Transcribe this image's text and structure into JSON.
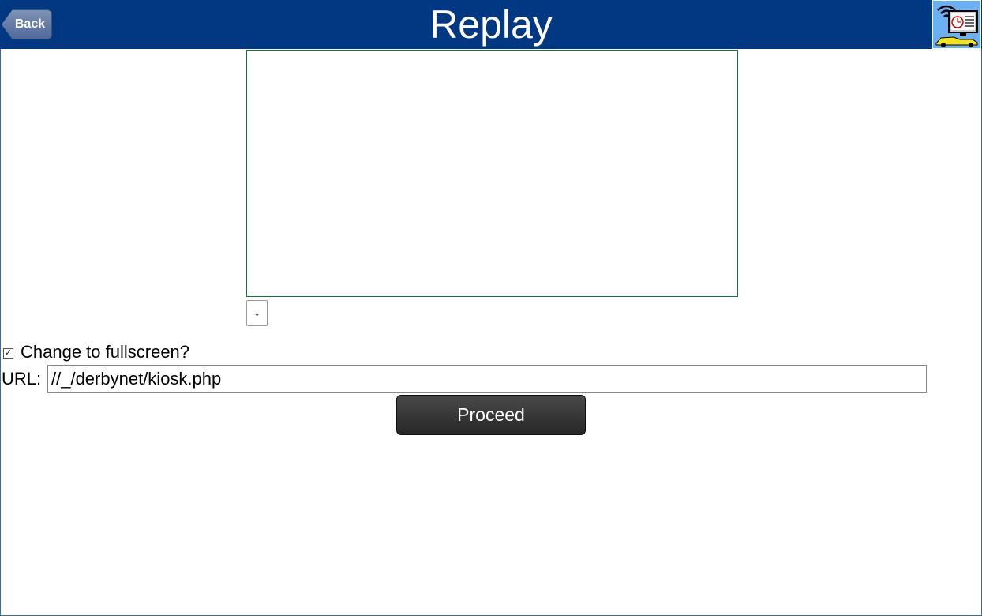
{
  "header": {
    "title": "Replay",
    "back_label": "Back",
    "kiosk_icon": "kiosk-wifi-monitor-car-icon",
    "bg_color": "#023882"
  },
  "replay": {
    "dropdown_icon": "chevron-down-icon",
    "dropdown_glyph": "⌄"
  },
  "fullscreen": {
    "checked": true,
    "checkbox_glyph": "✓",
    "label": "Change to fullscreen?"
  },
  "url": {
    "label": "URL:",
    "value": "//_/derbynet/kiosk.php"
  },
  "proceed": {
    "label": "Proceed"
  }
}
